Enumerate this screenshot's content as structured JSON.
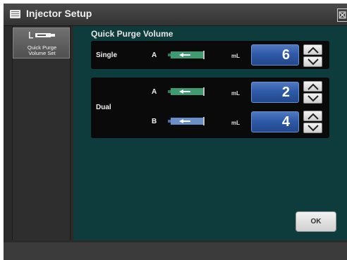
{
  "window": {
    "title": "Injector Setup"
  },
  "sidebar": {
    "items": [
      {
        "label_line1": "Quick Purge",
        "label_line2": "Volume Set",
        "icon": "syringe-icon"
      }
    ]
  },
  "main": {
    "title": "Quick Purge Volume",
    "single": {
      "label": "Single",
      "rows": [
        {
          "syringe": "A",
          "unit": "mL",
          "value": "6",
          "color": "#3f9a72"
        }
      ]
    },
    "dual": {
      "label": "Dual",
      "rows": [
        {
          "syringe": "A",
          "unit": "mL",
          "value": "2",
          "color": "#3f9a72"
        },
        {
          "syringe": "B",
          "unit": "mL",
          "value": "4",
          "color": "#6a8fc8"
        }
      ]
    }
  },
  "footer": {
    "ok_label": "OK"
  },
  "colors": {
    "accent": "#2f5aa8",
    "panel_bg": "#0e3b3b"
  }
}
